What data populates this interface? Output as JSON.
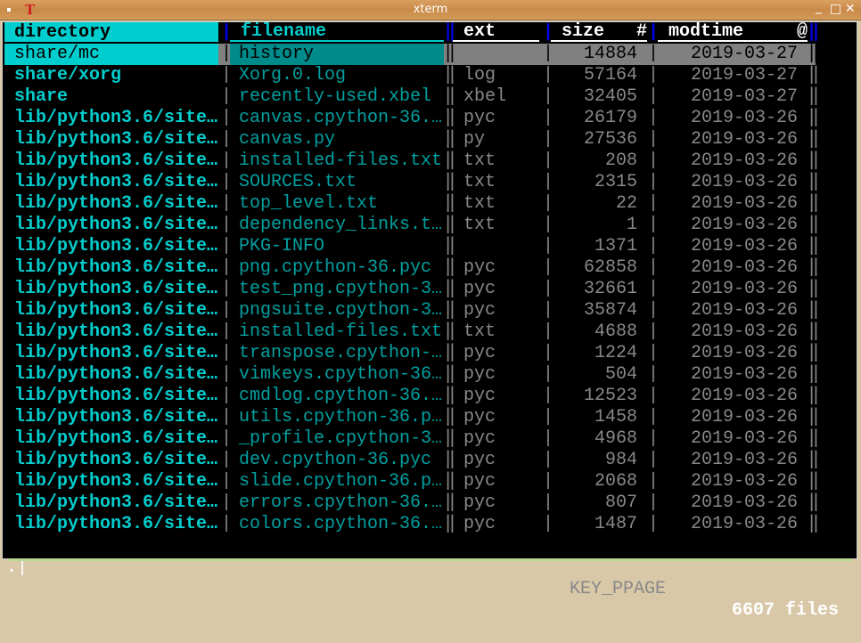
{
  "window": {
    "title": "xterm",
    "app_icon": "T"
  },
  "columns": {
    "directory": "directory",
    "filename": "filename",
    "ext": "ext",
    "size": "size",
    "size_marker": "#",
    "modtime": "modtime",
    "modtime_marker": "@"
  },
  "rows": [
    {
      "directory": "share/mc",
      "filename": "history",
      "ext": "",
      "size": "14884",
      "modtime": "2019-03-27"
    },
    {
      "directory": "share/xorg",
      "filename": "Xorg.0.log",
      "ext": "log",
      "size": "57164",
      "modtime": "2019-03-27"
    },
    {
      "directory": "share",
      "filename": "recently-used.xbel",
      "ext": "xbel",
      "size": "32405",
      "modtime": "2019-03-27"
    },
    {
      "directory": "lib/python3.6/site…",
      "filename": "canvas.cpython-36.…",
      "ext": "pyc",
      "size": "26179",
      "modtime": "2019-03-26"
    },
    {
      "directory": "lib/python3.6/site…",
      "filename": "canvas.py",
      "ext": "py",
      "size": "27536",
      "modtime": "2019-03-26"
    },
    {
      "directory": "lib/python3.6/site…",
      "filename": "installed-files.txt",
      "ext": "txt",
      "size": "208",
      "modtime": "2019-03-26"
    },
    {
      "directory": "lib/python3.6/site…",
      "filename": "SOURCES.txt",
      "ext": "txt",
      "size": "2315",
      "modtime": "2019-03-26"
    },
    {
      "directory": "lib/python3.6/site…",
      "filename": "top_level.txt",
      "ext": "txt",
      "size": "22",
      "modtime": "2019-03-26"
    },
    {
      "directory": "lib/python3.6/site…",
      "filename": "dependency_links.t…",
      "ext": "txt",
      "size": "1",
      "modtime": "2019-03-26"
    },
    {
      "directory": "lib/python3.6/site…",
      "filename": "PKG-INFO",
      "ext": "",
      "size": "1371",
      "modtime": "2019-03-26"
    },
    {
      "directory": "lib/python3.6/site…",
      "filename": "png.cpython-36.pyc",
      "ext": "pyc",
      "size": "62858",
      "modtime": "2019-03-26"
    },
    {
      "directory": "lib/python3.6/site…",
      "filename": "test_png.cpython-3…",
      "ext": "pyc",
      "size": "32661",
      "modtime": "2019-03-26"
    },
    {
      "directory": "lib/python3.6/site…",
      "filename": "pngsuite.cpython-3…",
      "ext": "pyc",
      "size": "35874",
      "modtime": "2019-03-26"
    },
    {
      "directory": "lib/python3.6/site…",
      "filename": "installed-files.txt",
      "ext": "txt",
      "size": "4688",
      "modtime": "2019-03-26"
    },
    {
      "directory": "lib/python3.6/site…",
      "filename": "transpose.cpython-…",
      "ext": "pyc",
      "size": "1224",
      "modtime": "2019-03-26"
    },
    {
      "directory": "lib/python3.6/site…",
      "filename": "vimkeys.cpython-36…",
      "ext": "pyc",
      "size": "504",
      "modtime": "2019-03-26"
    },
    {
      "directory": "lib/python3.6/site…",
      "filename": "cmdlog.cpython-36.…",
      "ext": "pyc",
      "size": "12523",
      "modtime": "2019-03-26"
    },
    {
      "directory": "lib/python3.6/site…",
      "filename": "utils.cpython-36.p…",
      "ext": "pyc",
      "size": "1458",
      "modtime": "2019-03-26"
    },
    {
      "directory": "lib/python3.6/site…",
      "filename": "_profile.cpython-3…",
      "ext": "pyc",
      "size": "4968",
      "modtime": "2019-03-26"
    },
    {
      "directory": "lib/python3.6/site…",
      "filename": "dev.cpython-36.pyc",
      "ext": "pyc",
      "size": "984",
      "modtime": "2019-03-26"
    },
    {
      "directory": "lib/python3.6/site…",
      "filename": "slide.cpython-36.p…",
      "ext": "pyc",
      "size": "2068",
      "modtime": "2019-03-26"
    },
    {
      "directory": "lib/python3.6/site…",
      "filename": "errors.cpython-36.…",
      "ext": "pyc",
      "size": "807",
      "modtime": "2019-03-26"
    },
    {
      "directory": "lib/python3.6/site…",
      "filename": "colors.cpython-36.…",
      "ext": "pyc",
      "size": "1487",
      "modtime": "2019-03-26"
    }
  ],
  "status": {
    "prompt": ".",
    "last_key": "KEY_PPAGE",
    "count": "6607 files"
  },
  "colors": {
    "key_column": "#00cdcd",
    "filename": "#00a0a0",
    "cell": "#888888",
    "selected": "#808080",
    "separator": "#0000ee"
  }
}
